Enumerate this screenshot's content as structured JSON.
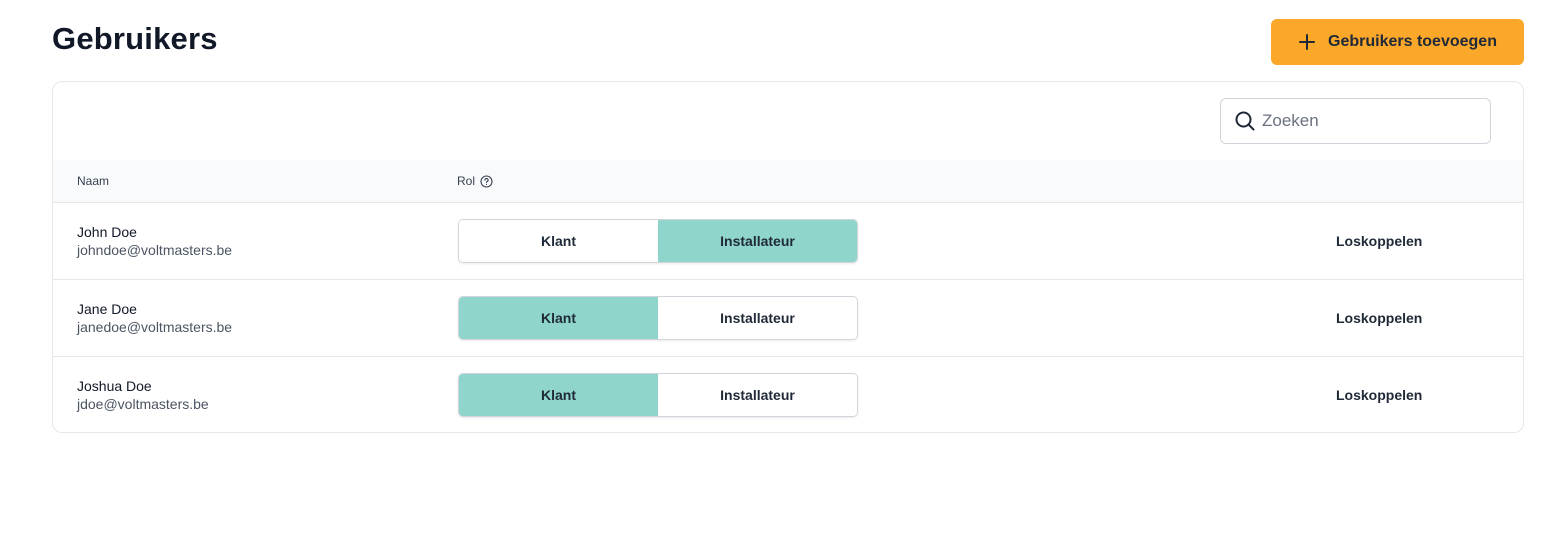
{
  "header": {
    "title": "Gebruikers",
    "add_button_label": "Gebruikers toevoegen",
    "add_button_icon": "plus-icon"
  },
  "search": {
    "placeholder": "Zoeken",
    "value": "",
    "icon": "search-icon"
  },
  "table": {
    "columns": {
      "name": "Naam",
      "role": "Rol",
      "role_help_icon": "question-circle-icon"
    },
    "role_options": [
      "Klant",
      "Installateur"
    ],
    "unlink_label": "Loskoppelen",
    "rows": [
      {
        "name": "John Doe",
        "email": "johndoe@voltmasters.be",
        "role": "Installateur"
      },
      {
        "name": "Jane Doe",
        "email": "janedoe@voltmasters.be",
        "role": "Klant"
      },
      {
        "name": "Joshua Doe",
        "email": "jdoe@voltmasters.be",
        "role": "Klant"
      }
    ]
  },
  "colors": {
    "accent_button": "#faa72a",
    "role_active": "#8fd5cc",
    "border": "#e5e7eb",
    "header_bg": "#f9fafb"
  }
}
